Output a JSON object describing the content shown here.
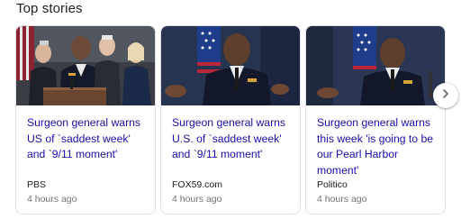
{
  "section": {
    "title": "Top stories"
  },
  "stories": [
    {
      "headline": "Surgeon general warns US of `saddest week' and `9/11 moment'",
      "source": "PBS",
      "time": "4 hours ago"
    },
    {
      "headline": "Surgeon general warns U.S. of `saddest week' and `9/11 moment'",
      "source": "FOX59.com",
      "time": "4 hours ago"
    },
    {
      "headline": "Surgeon general warns this week 'is going to be our Pearl Harbor moment'",
      "source": "Politico",
      "time": "4 hours ago"
    }
  ],
  "carousel": {
    "next_icon": "chevron-right-icon"
  },
  "colors": {
    "headline_link": "#1a0dab",
    "meta_text": "#70757a",
    "card_border": "#dfe1e5"
  }
}
